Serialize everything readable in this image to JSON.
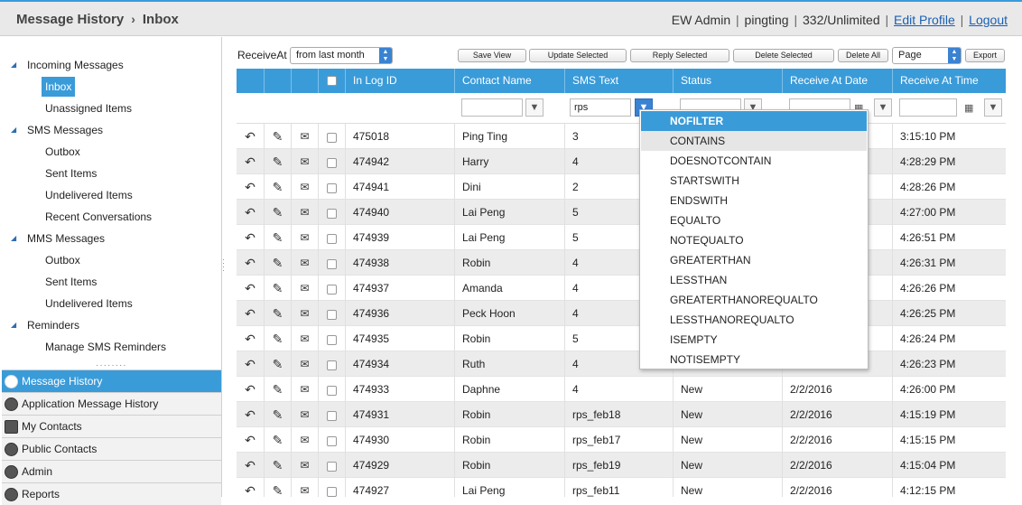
{
  "header": {
    "breadcrumb": [
      "Message History",
      "Inbox"
    ],
    "breadcrumb_sep": "›",
    "user": "EW Admin",
    "login": "pingting",
    "quota": "332/Unlimited",
    "edit_profile": "Edit Profile",
    "logout": "Logout"
  },
  "sidebar": {
    "tree": [
      {
        "label": "Incoming Messages",
        "group": true
      },
      {
        "label": "Inbox",
        "selected": true
      },
      {
        "label": "Unassigned Items"
      },
      {
        "label": "SMS Messages",
        "group": true
      },
      {
        "label": "Outbox"
      },
      {
        "label": "Sent Items"
      },
      {
        "label": "Undelivered Items"
      },
      {
        "label": "Recent Conversations"
      },
      {
        "label": "MMS Messages",
        "group": true
      },
      {
        "label": "Outbox"
      },
      {
        "label": "Sent Items"
      },
      {
        "label": "Undelivered Items"
      },
      {
        "label": "Reminders",
        "group": true
      },
      {
        "label": "Manage SMS Reminders"
      }
    ],
    "accordion": [
      {
        "label": "Message History",
        "active": true
      },
      {
        "label": "Application Message History"
      },
      {
        "label": "My Contacts"
      },
      {
        "label": "Public Contacts"
      },
      {
        "label": "Admin"
      },
      {
        "label": "Reports"
      }
    ]
  },
  "toolbar": {
    "receive_label": "ReceiveAt",
    "receive_value": "from last month",
    "save_view": "Save View",
    "update_selected": "Update Selected",
    "reply_selected": "Reply Selected",
    "delete_selected": "Delete Selected",
    "delete_all": "Delete All",
    "page_value": "Page",
    "export": "Export"
  },
  "grid": {
    "columns": {
      "in_log_id": "In Log ID",
      "contact_name": "Contact Name",
      "sms_text": "SMS Text",
      "status": "Status",
      "receive_date": "Receive At Date",
      "receive_time": "Receive At Time"
    },
    "filter": {
      "sms_text": "rps"
    },
    "rows": [
      {
        "id": "475018",
        "name": "Ping Ting",
        "text": "3",
        "status": "",
        "date": "",
        "time": "3:15:10 PM"
      },
      {
        "id": "474942",
        "name": "Harry",
        "text": "4",
        "status": "",
        "date": "",
        "time": "4:28:29 PM"
      },
      {
        "id": "474941",
        "name": "Dini",
        "text": "2",
        "status": "",
        "date": "",
        "time": "4:28:26 PM"
      },
      {
        "id": "474940",
        "name": "Lai Peng",
        "text": "5",
        "status": "",
        "date": "",
        "time": "4:27:00 PM"
      },
      {
        "id": "474939",
        "name": "Lai Peng",
        "text": "5",
        "status": "",
        "date": "",
        "time": "4:26:51 PM"
      },
      {
        "id": "474938",
        "name": "Robin",
        "text": "4",
        "status": "",
        "date": "",
        "time": "4:26:31 PM"
      },
      {
        "id": "474937",
        "name": "Amanda",
        "text": "4",
        "status": "",
        "date": "",
        "time": "4:26:26 PM"
      },
      {
        "id": "474936",
        "name": "Peck Hoon",
        "text": "4",
        "status": "",
        "date": "",
        "time": "4:26:25 PM"
      },
      {
        "id": "474935",
        "name": "Robin",
        "text": "5",
        "status": "",
        "date": "",
        "time": "4:26:24 PM"
      },
      {
        "id": "474934",
        "name": "Ruth",
        "text": "4",
        "status": "",
        "date": "",
        "time": "4:26:23 PM"
      },
      {
        "id": "474933",
        "name": "Daphne",
        "text": "4",
        "status": "New",
        "date": "2/2/2016",
        "time": "4:26:00 PM"
      },
      {
        "id": "474931",
        "name": "Robin",
        "text": "rps_feb18",
        "status": "New",
        "date": "2/2/2016",
        "time": "4:15:19 PM"
      },
      {
        "id": "474930",
        "name": "Robin",
        "text": "rps_feb17",
        "status": "New",
        "date": "2/2/2016",
        "time": "4:15:15 PM"
      },
      {
        "id": "474929",
        "name": "Robin",
        "text": "rps_feb19",
        "status": "New",
        "date": "2/2/2016",
        "time": "4:15:04 PM"
      },
      {
        "id": "474927",
        "name": "Lai Peng",
        "text": "rps_feb11",
        "status": "New",
        "date": "2/2/2016",
        "time": "4:12:15 PM"
      }
    ]
  },
  "filter_menu": {
    "options": [
      "NOFILTER",
      "CONTAINS",
      "DOESNOTCONTAIN",
      "STARTSWITH",
      "ENDSWITH",
      "EQUALTO",
      "NOTEQUALTO",
      "GREATERTHAN",
      "LESSTHAN",
      "GREATERTHANOREQUALTO",
      "LESSTHANOREQUALTO",
      "ISEMPTY",
      "NOTISEMPTY"
    ],
    "selected_index": 0,
    "hover_index": 1
  },
  "colors": {
    "accent": "#3a9bd9",
    "header_bg": "#e9e9e9",
    "link": "#1a5fb4"
  }
}
